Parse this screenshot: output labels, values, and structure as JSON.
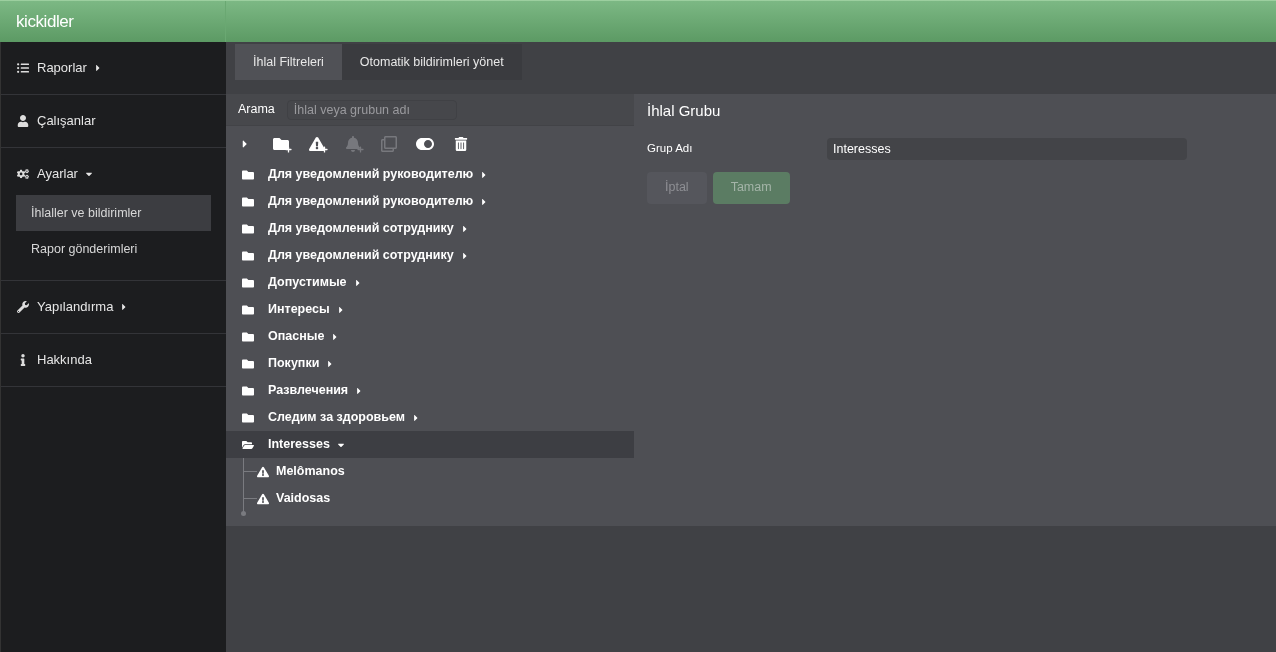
{
  "logo": "kickidler",
  "sidebar": {
    "sections": [
      {
        "kind": "list",
        "label": "Raporlar",
        "expanded": false
      },
      {
        "kind": "user",
        "label": "Çalışanlar"
      },
      {
        "kind": "gears",
        "label": "Ayarlar",
        "expanded": true,
        "children": [
          {
            "label": "İhlaller ve bildirimler",
            "selected": true
          },
          {
            "label": "Rapor gönderimleri",
            "selected": false
          }
        ]
      },
      {
        "kind": "wrench",
        "label": "Yapılandırma",
        "expanded": false
      },
      {
        "kind": "info",
        "label": "Hakkında"
      }
    ]
  },
  "tabs": [
    {
      "label": "İhlal Filtreleri",
      "selected": true
    },
    {
      "label": "Otomatik bildirimleri yönet",
      "selected": false
    }
  ],
  "search": {
    "label": "Arama",
    "placeholder": "İhlal veya grubun adı"
  },
  "toolbar": [
    {
      "kind": "expand",
      "disabled": false
    },
    {
      "kind": "add-folder",
      "disabled": false
    },
    {
      "kind": "add-violation",
      "disabled": false
    },
    {
      "kind": "add-notification",
      "disabled": true
    },
    {
      "kind": "copy",
      "disabled": true
    },
    {
      "kind": "toggle",
      "disabled": false
    },
    {
      "kind": "delete",
      "disabled": false
    }
  ],
  "tree": [
    {
      "label": "Для уведомлений руководителю",
      "expanded": false,
      "selected": false
    },
    {
      "label": "Для уведомлений руководителю",
      "expanded": false,
      "selected": false
    },
    {
      "label": "Для уведомлений сотруднику",
      "expanded": false,
      "selected": false
    },
    {
      "label": "Для уведомлений сотруднику",
      "expanded": false,
      "selected": false
    },
    {
      "label": "Допустимые",
      "expanded": false,
      "selected": false
    },
    {
      "label": "Интересы",
      "expanded": false,
      "selected": false
    },
    {
      "label": "Опасные",
      "expanded": false,
      "selected": false
    },
    {
      "label": "Покупки",
      "expanded": false,
      "selected": false
    },
    {
      "label": "Развлечения",
      "expanded": false,
      "selected": false
    },
    {
      "label": "Следим за здоровьем",
      "expanded": false,
      "selected": false
    },
    {
      "label": "Interesses",
      "expanded": true,
      "selected": true,
      "children": [
        {
          "label": "Melômanos",
          "selected": false
        },
        {
          "label": "Vaidosas",
          "selected": false
        }
      ]
    }
  ],
  "detail": {
    "title": "İhlal Grubu",
    "field_label": "Grup Adı",
    "field_value": "Interesses",
    "buttons": [
      {
        "kind": "cancel",
        "label": "İptal",
        "disabled": true
      },
      {
        "kind": "ok",
        "label": "Tamam",
        "disabled": true
      }
    ]
  }
}
